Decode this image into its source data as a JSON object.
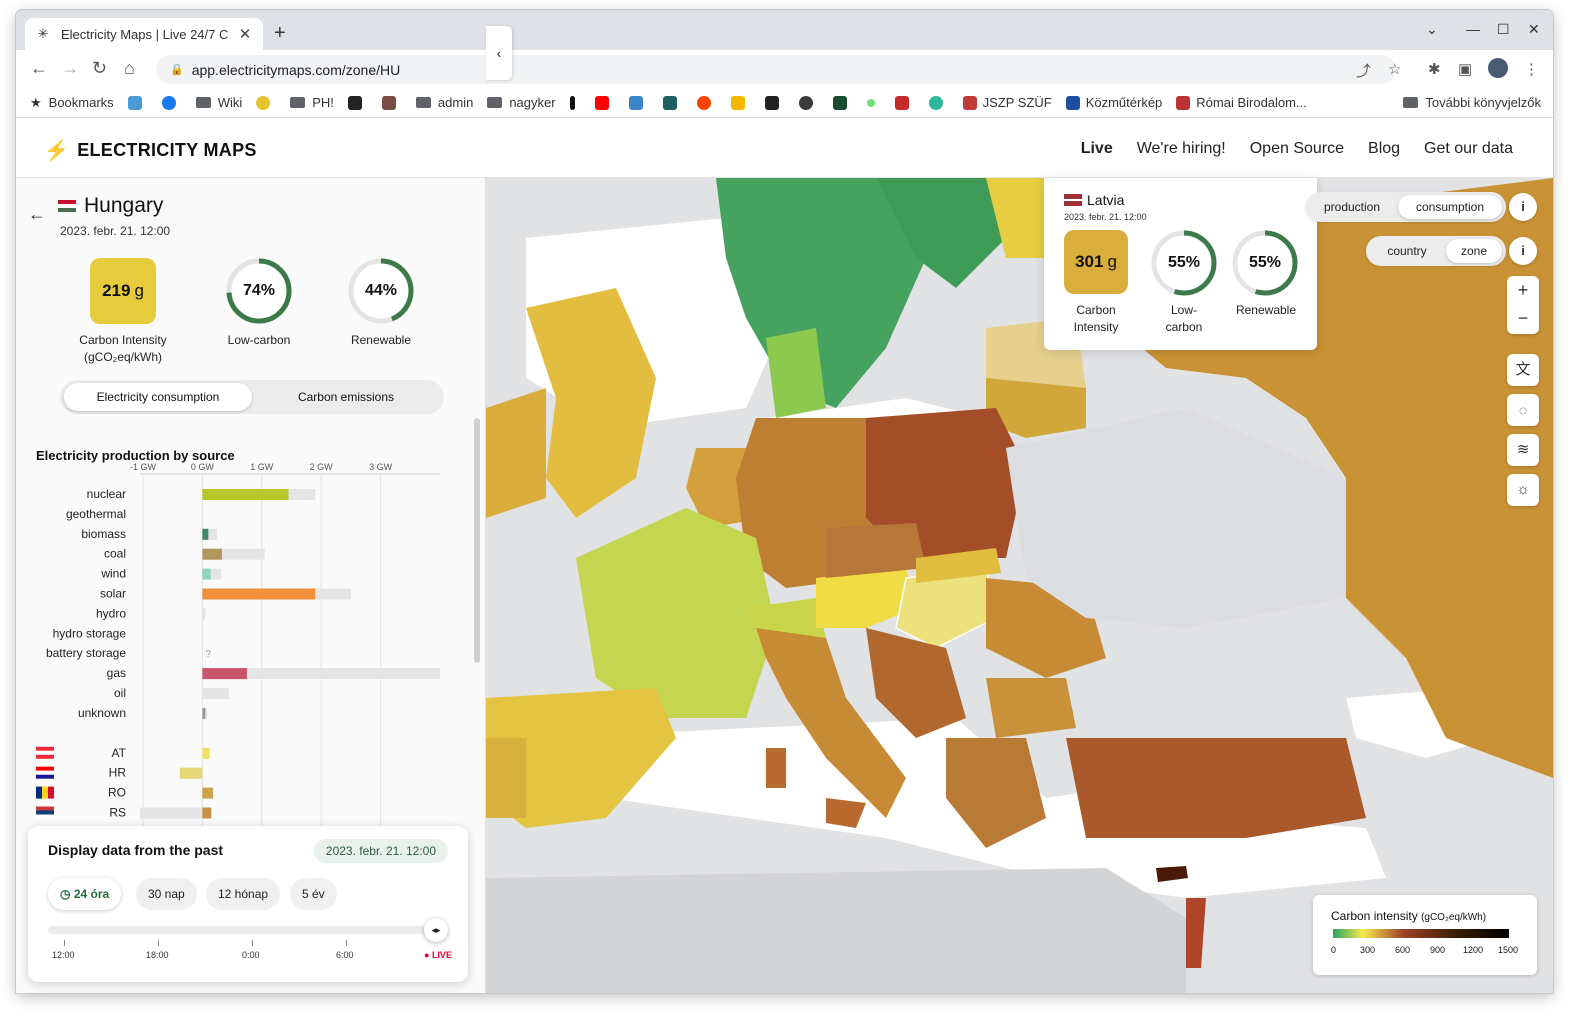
{
  "browser": {
    "tab_title": "Electricity Maps | Live 24/7 C",
    "url": "app.electricitymaps.com/zone/HU",
    "bookmarks": [
      "Bookmarks",
      "Wiki",
      "PH!",
      "admin",
      "nagyker",
      "JSZP SZÜF",
      "Közműtérkép",
      "Római Birodalom..."
    ],
    "other_bookmarks": "További könyvjelzők"
  },
  "header": {
    "logo": "ELECTRICITY MAPS",
    "nav": [
      "Live",
      "We're hiring!",
      "Open Source",
      "Blog",
      "Get our data"
    ]
  },
  "zone": {
    "name": "Hungary",
    "date": "2023. febr. 21. 12:00",
    "carbon_intensity_value": "219",
    "carbon_intensity_unit": "g",
    "carbon_intensity_label": "Carbon Intensity",
    "carbon_intensity_sub": "(gCO₂eq/kWh)",
    "low_carbon": "74%",
    "low_carbon_label": "Low-carbon",
    "renewable": "44%",
    "renewable_label": "Renewable",
    "low_carbon_frac": 0.74,
    "renewable_frac": 0.44
  },
  "mode_toggle": {
    "consumption": "Electricity consumption",
    "emissions": "Carbon emissions"
  },
  "chart_data": {
    "type": "bar",
    "title": "Electricity production by source",
    "xlabel": "",
    "ylabel": "",
    "x_ticks": [
      "-1 GW",
      "0 GW",
      "1 GW",
      "2 GW",
      "3 GW"
    ],
    "xlim": [
      -1.05,
      4.0
    ],
    "categories": [
      "nuclear",
      "geothermal",
      "biomass",
      "coal",
      "wind",
      "solar",
      "hydro",
      "hydro storage",
      "battery storage",
      "gas",
      "oil",
      "unknown",
      "AT",
      "HR",
      "RO",
      "RS"
    ],
    "series": [
      {
        "values": [
          1.45,
          0,
          0.1,
          0.33,
          0.14,
          1.9,
          0,
          0,
          0,
          0.75,
          0,
          0.05,
          0.12,
          -0.38,
          0.18,
          0.15
        ]
      },
      {
        "values": [
          1.9,
          0,
          0.25,
          1.05,
          0.32,
          2.5,
          0.05,
          0,
          0,
          4.0,
          0.45,
          0.08,
          0.12,
          -0.38,
          0.18,
          -1.05
        ]
      }
    ],
    "colors": [
      "#b6c72a",
      "#888888",
      "#3e8a63",
      "#b3965b",
      "#8fd3c0",
      "#f3913a",
      "#3c7dc4",
      "#1b4b8a",
      "#aaaaaa",
      "#c9546b",
      "#867d66",
      "#999999",
      "#f0df60",
      "#e8d775",
      "#cda24a",
      "#c79144"
    ],
    "missing_marker": "?"
  },
  "time": {
    "title": "Display data from the past",
    "selected": "2023. febr. 21. 12:00",
    "ranges": [
      "24 óra",
      "30 nap",
      "12 hónap",
      "5 év"
    ],
    "ticks": [
      "12:00",
      "18:00",
      "0:00",
      "6:00"
    ],
    "live": "LIVE",
    "thumb_icon": "◂▸"
  },
  "tooltip": {
    "zone": "Latvia",
    "date": "2023. febr. 21. 12:00",
    "carbon_intensity_value": "301",
    "carbon_intensity_unit": "g",
    "carbon_intensity_label": "Carbon Intensity",
    "low_carbon": "55%",
    "low_carbon_label": "Low-carbon",
    "renewable": "55%",
    "renewable_label": "Renewable",
    "low_carbon_frac": 0.55,
    "renewable_frac": 0.55
  },
  "map_controls": {
    "production": "production",
    "consumption": "consumption",
    "country": "country",
    "zone": "zone",
    "info": "i",
    "zoom_in": "+",
    "zoom_out": "−"
  },
  "legend": {
    "title": "Carbon intensity",
    "unit": "(gCO₂eq/kWh)",
    "values": [
      "0",
      "300",
      "600",
      "900",
      "1200",
      "1500"
    ]
  }
}
